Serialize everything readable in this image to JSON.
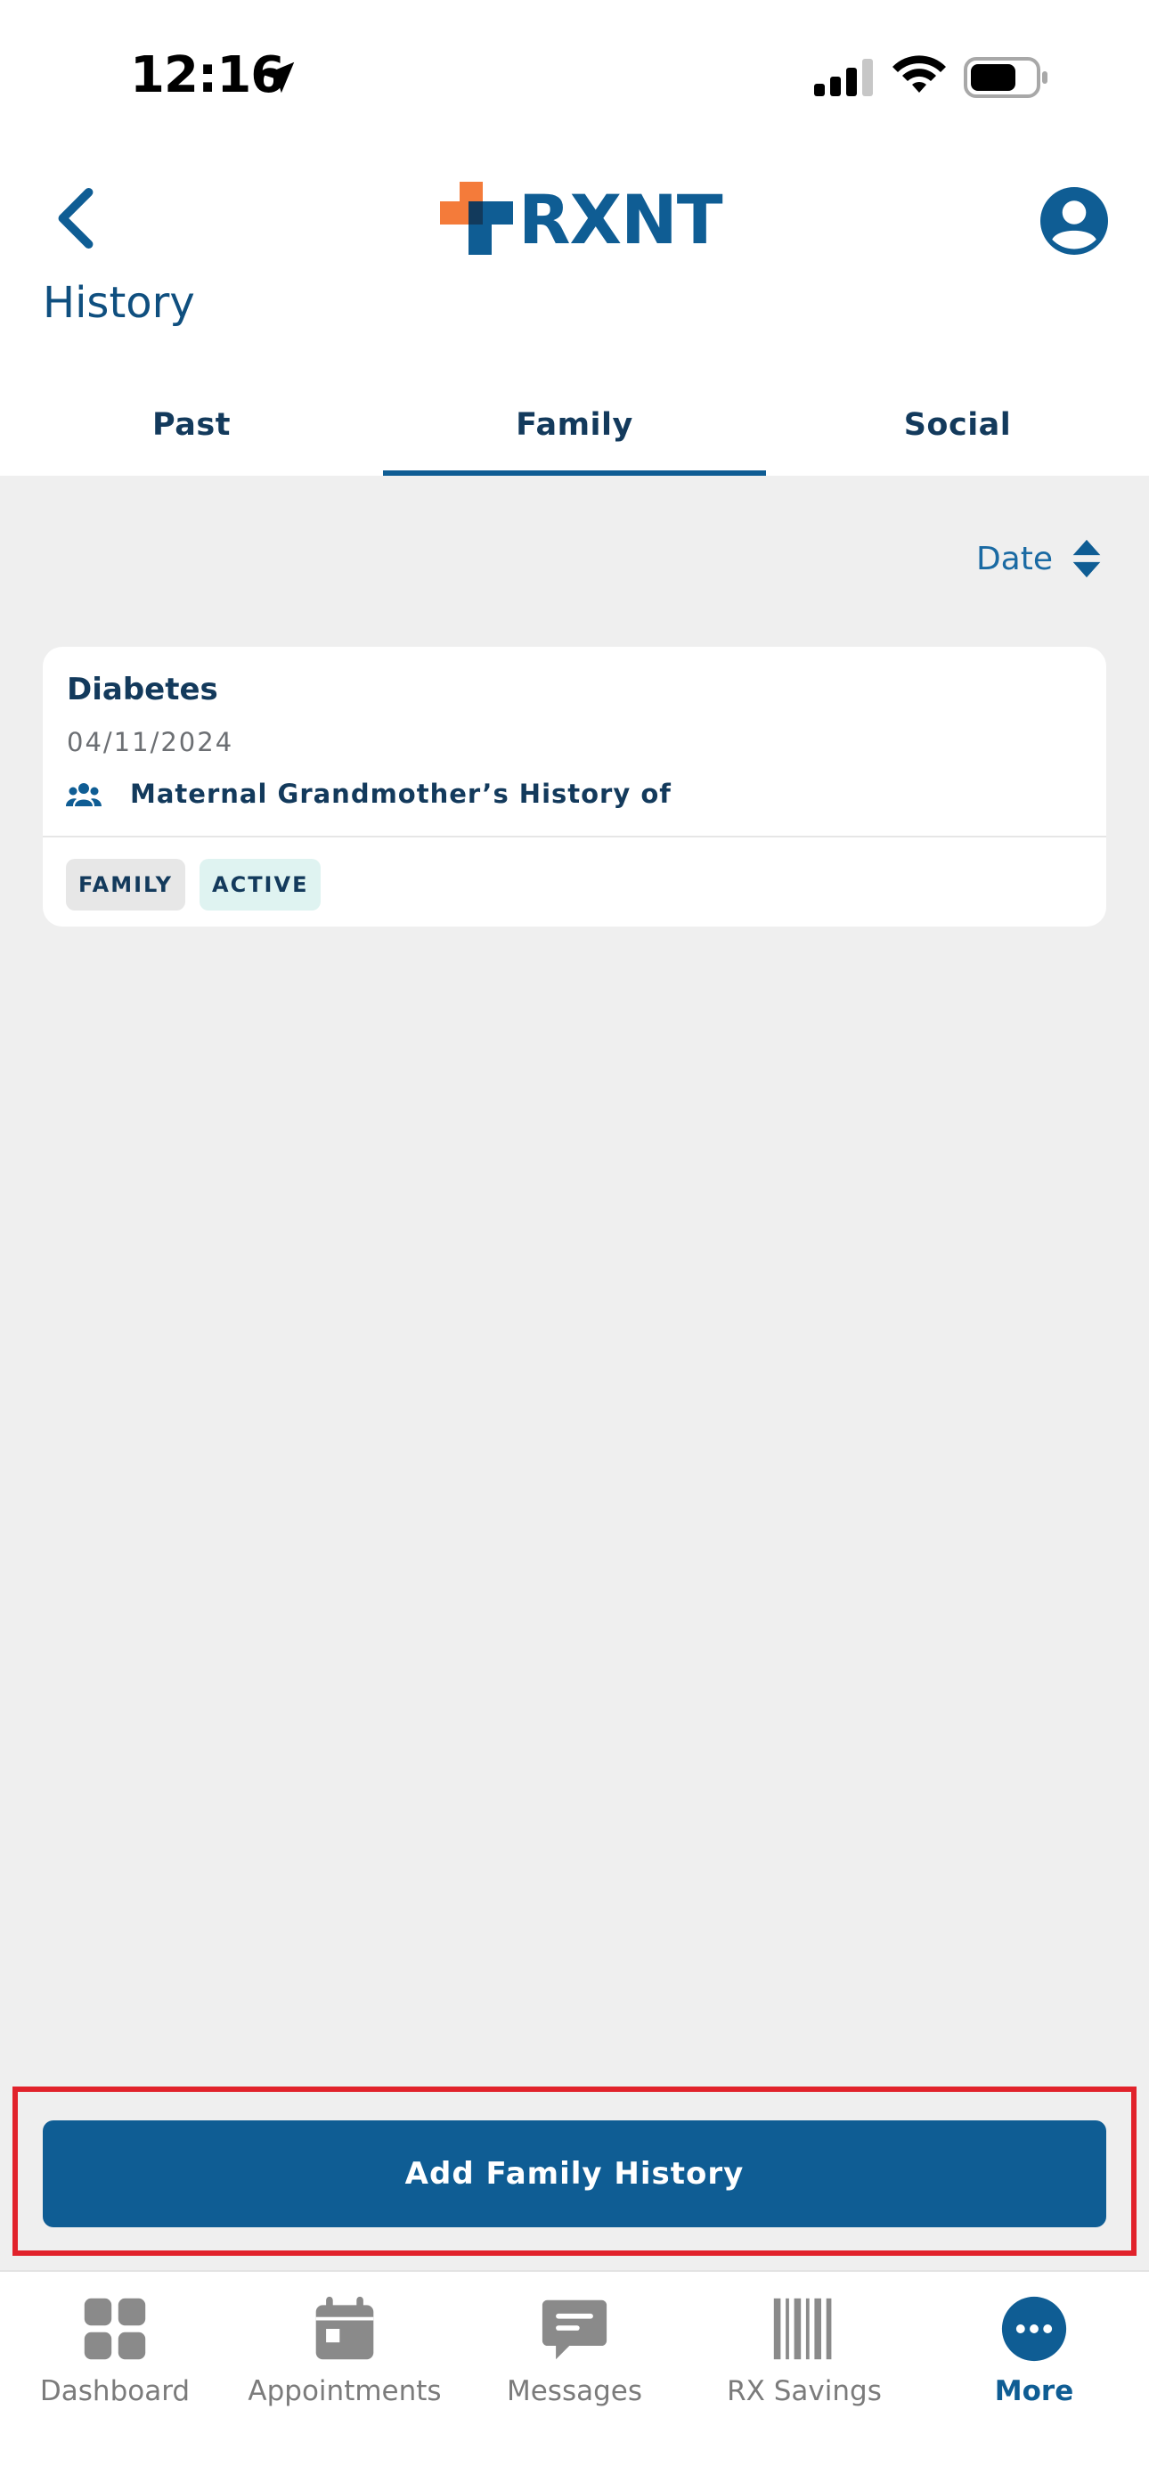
{
  "status_bar": {
    "time": "12:16"
  },
  "header": {
    "logo_text": "RXNT",
    "page_title": "History"
  },
  "tabs": [
    {
      "label": "Past",
      "active": false
    },
    {
      "label": "Family",
      "active": true
    },
    {
      "label": "Social",
      "active": false
    }
  ],
  "sort": {
    "label": "Date"
  },
  "records": [
    {
      "title": "Diabetes",
      "date": "04/11/2024",
      "relation": "Maternal Grandmother’s History of",
      "badges": [
        "FAMILY",
        "ACTIVE"
      ]
    }
  ],
  "add_button": {
    "label": "Add Family History"
  },
  "nav": [
    {
      "label": "Dashboard",
      "icon": "dashboard-icon"
    },
    {
      "label": "Appointments",
      "icon": "calendar-icon"
    },
    {
      "label": "Messages",
      "icon": "message-icon"
    },
    {
      "label": "RX Savings",
      "icon": "barcode-icon"
    },
    {
      "label": "More",
      "icon": "more-icon",
      "active": true
    }
  ],
  "colors": {
    "brand_blue": "#0f5d94",
    "brand_orange": "#f47b3a",
    "highlight_red": "#e1222b"
  }
}
